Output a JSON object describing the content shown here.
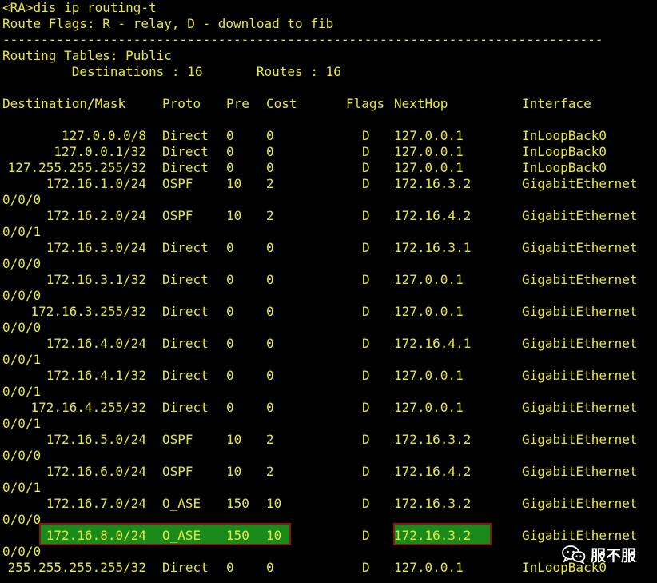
{
  "terminal": {
    "prompt_command": "<RA>dis ip routing-t",
    "route_flags": "Route Flags: R - relay, D - download to fib",
    "separator": "------------------------------------------------------------------------------",
    "routing_tables": "Routing Tables: Public",
    "summary": "         Destinations : 16       Routes : 16",
    "headers": {
      "destination": "Destination/Mask",
      "proto": "Proto",
      "pre": "Pre",
      "cost": "Cost",
      "flags": "Flags",
      "nexthop": "NextHop",
      "interface": "Interface"
    },
    "routes": [
      {
        "dest": "127.0.0.0/8",
        "proto": "Direct",
        "pre": "0",
        "cost": "0",
        "flags": "D",
        "nexthop": "127.0.0.1",
        "iface": "InLoopBack0",
        "iface_cont": ""
      },
      {
        "dest": "127.0.0.1/32",
        "proto": "Direct",
        "pre": "0",
        "cost": "0",
        "flags": "D",
        "nexthop": "127.0.0.1",
        "iface": "InLoopBack0",
        "iface_cont": ""
      },
      {
        "dest": "127.255.255.255/32",
        "proto": "Direct",
        "pre": "0",
        "cost": "0",
        "flags": "D",
        "nexthop": "127.0.0.1",
        "iface": "InLoopBack0",
        "iface_cont": ""
      },
      {
        "dest": "172.16.1.0/24",
        "proto": "OSPF",
        "pre": "10",
        "cost": "2",
        "flags": "D",
        "nexthop": "172.16.3.2",
        "iface": "GigabitEthernet",
        "iface_cont": "0/0/0"
      },
      {
        "dest": "172.16.2.0/24",
        "proto": "OSPF",
        "pre": "10",
        "cost": "2",
        "flags": "D",
        "nexthop": "172.16.4.2",
        "iface": "GigabitEthernet",
        "iface_cont": "0/0/1"
      },
      {
        "dest": "172.16.3.0/24",
        "proto": "Direct",
        "pre": "0",
        "cost": "0",
        "flags": "D",
        "nexthop": "172.16.3.1",
        "iface": "GigabitEthernet",
        "iface_cont": "0/0/0"
      },
      {
        "dest": "172.16.3.1/32",
        "proto": "Direct",
        "pre": "0",
        "cost": "0",
        "flags": "D",
        "nexthop": "127.0.0.1",
        "iface": "GigabitEthernet",
        "iface_cont": "0/0/0"
      },
      {
        "dest": "172.16.3.255/32",
        "proto": "Direct",
        "pre": "0",
        "cost": "0",
        "flags": "D",
        "nexthop": "127.0.0.1",
        "iface": "GigabitEthernet",
        "iface_cont": "0/0/0"
      },
      {
        "dest": "172.16.4.0/24",
        "proto": "Direct",
        "pre": "0",
        "cost": "0",
        "flags": "D",
        "nexthop": "172.16.4.1",
        "iface": "GigabitEthernet",
        "iface_cont": "0/0/1"
      },
      {
        "dest": "172.16.4.1/32",
        "proto": "Direct",
        "pre": "0",
        "cost": "0",
        "flags": "D",
        "nexthop": "127.0.0.1",
        "iface": "GigabitEthernet",
        "iface_cont": "0/0/1"
      },
      {
        "dest": "172.16.4.255/32",
        "proto": "Direct",
        "pre": "0",
        "cost": "0",
        "flags": "D",
        "nexthop": "127.0.0.1",
        "iface": "GigabitEthernet",
        "iface_cont": "0/0/1"
      },
      {
        "dest": "172.16.5.0/24",
        "proto": "OSPF",
        "pre": "10",
        "cost": "2",
        "flags": "D",
        "nexthop": "172.16.3.2",
        "iface": "GigabitEthernet",
        "iface_cont": "0/0/0"
      },
      {
        "dest": "172.16.6.0/24",
        "proto": "OSPF",
        "pre": "10",
        "cost": "2",
        "flags": "D",
        "nexthop": "172.16.4.2",
        "iface": "GigabitEthernet",
        "iface_cont": "0/0/1"
      },
      {
        "dest": "172.16.7.0/24",
        "proto": "O_ASE",
        "pre": "150",
        "cost": "10",
        "flags": "D",
        "nexthop": "172.16.3.2",
        "iface": "GigabitEthernet",
        "iface_cont": "0/0/0"
      },
      {
        "dest": "172.16.8.0/24",
        "proto": "O_ASE",
        "pre": "150",
        "cost": "10",
        "flags": "D",
        "nexthop": "172.16.3.2",
        "iface": "GigabitEthernet",
        "iface_cont": "0/0/0",
        "highlighted": true
      },
      {
        "dest": "255.255.255.255/32",
        "proto": "Direct",
        "pre": "0",
        "cost": "0",
        "flags": "D",
        "nexthop": "127.0.0.1",
        "iface": "InLoopBack0",
        "iface_cont": ""
      }
    ]
  },
  "watermark": {
    "icon": "wechat-icon",
    "text": "服不服"
  },
  "colors": {
    "background": "#000000",
    "text": "#e8e83c",
    "highlight_fill": "#1a8a1a",
    "highlight_border": "#8a1616"
  }
}
